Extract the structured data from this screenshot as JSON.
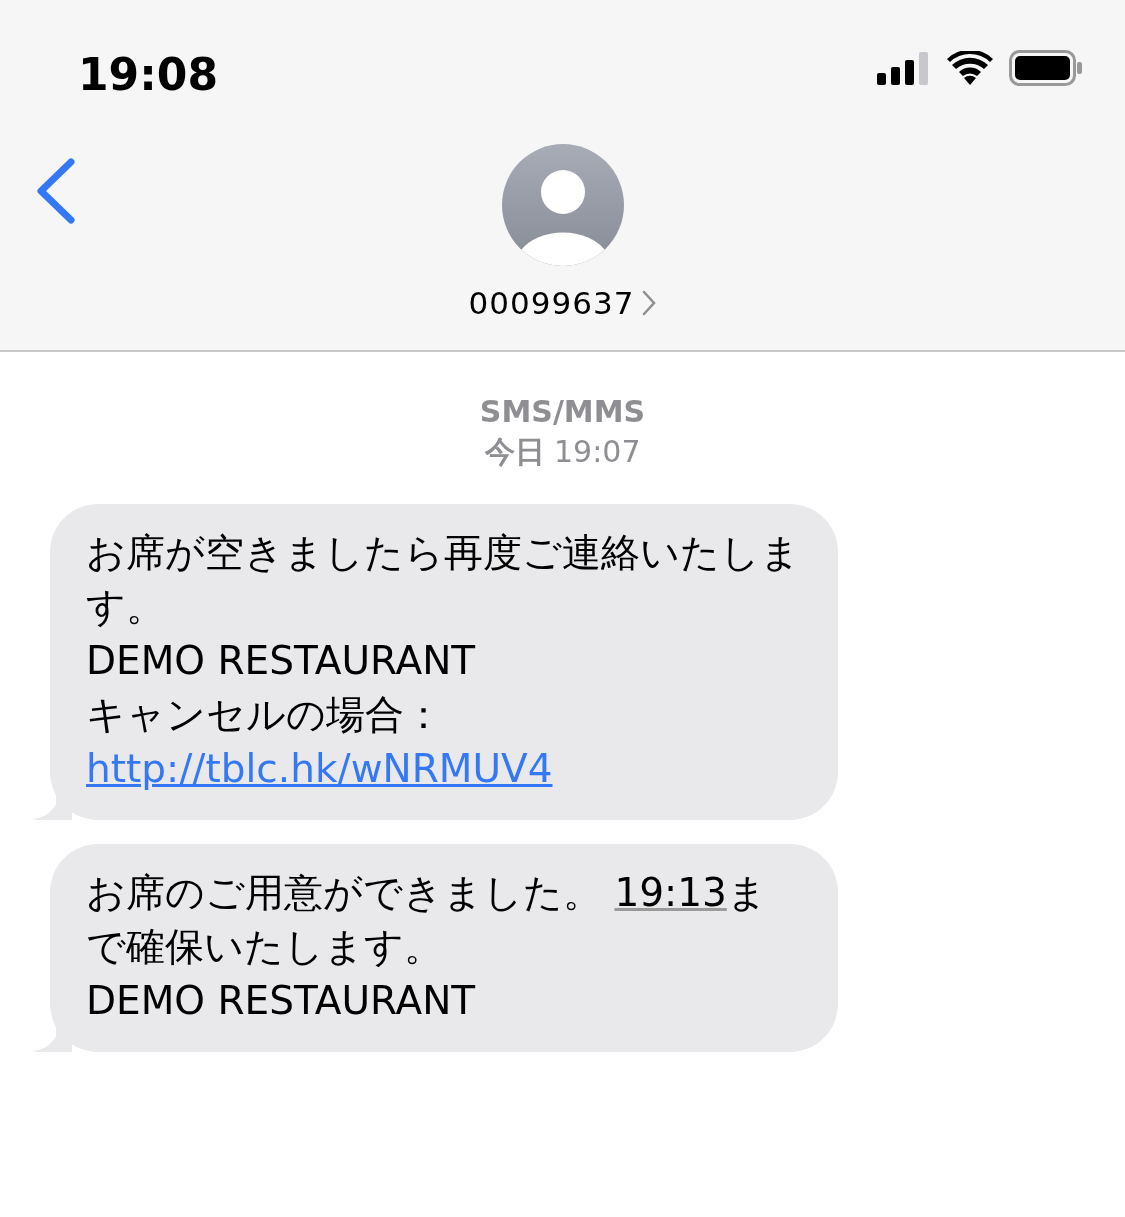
{
  "status_bar": {
    "time": "19:08"
  },
  "header": {
    "contact": "00099637"
  },
  "thread": {
    "service": "SMS/MMS",
    "timestamp": "**今日** 19:07"
  },
  "messages": [
    {
      "lines": [
        [
          {
            "kind": "text",
            "text": "お席が空きましたら再度ご連絡いたします。"
          }
        ],
        [
          {
            "kind": "text",
            "text": "DEMO RESTAURANT"
          }
        ],
        [
          {
            "kind": "text",
            "text": "キャンセルの場合： "
          },
          {
            "kind": "link",
            "text": "http://tblc.hk/wNRMUV4"
          }
        ]
      ]
    },
    {
      "lines": [
        [
          {
            "kind": "text",
            "text": "お席のご用意ができました。 "
          },
          {
            "kind": "detected",
            "text": "19:13"
          },
          {
            "kind": "text",
            "text": "まで確保いたします。"
          }
        ],
        [
          {
            "kind": "text",
            "text": "DEMO RESTAURANT"
          }
        ]
      ]
    }
  ]
}
